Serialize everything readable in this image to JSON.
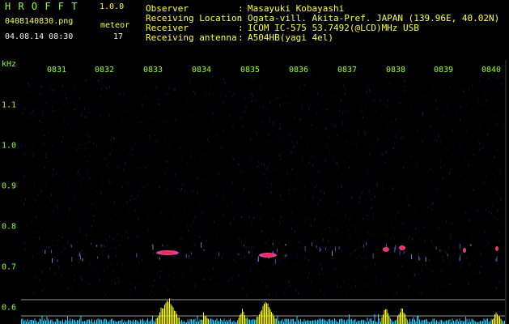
{
  "header": {
    "logo": "H R O F F T",
    "version": "1.0.0",
    "filename": "0408140830.png",
    "meteor_label": "meteor",
    "datetime": "04.08.14 08:30",
    "meteor_count": "17"
  },
  "info": [
    {
      "key": "Observer",
      "colon": ":",
      "value": "Masayuki Kobayashi"
    },
    {
      "key": "Receiving Location",
      "colon": ":",
      "value": "Ogata-vill. Akita-Pref. JAPAN (139.96E, 40.02N)"
    },
    {
      "key": "Receiver",
      "colon": ":",
      "value": "ICOM IC-575 53.7492(@LCD)MHz USB"
    },
    {
      "key": "Receiving antenna",
      "colon": ":",
      "value": "A504HB(yagi 4el)"
    }
  ],
  "axis": {
    "unit": "kHz",
    "time_labels": [
      "0831",
      "0832",
      "0833",
      "0834",
      "0835",
      "0836",
      "0837",
      "0838",
      "0839",
      "0840"
    ],
    "freq_labels": [
      "1.1",
      "1.0",
      "0.9",
      "0.8",
      "0.7",
      "0.6"
    ]
  },
  "colors": {
    "label_green": "#8fff2e",
    "label_yellow": "#ffff3a",
    "background": "#000000",
    "noise_blue": "#1a2a6e",
    "echo_red": "#ff2a3a",
    "echo_magenta": "#ff4fc8",
    "level_yellow": "#ffff00",
    "level_cyan": "#2fd0ff"
  }
}
